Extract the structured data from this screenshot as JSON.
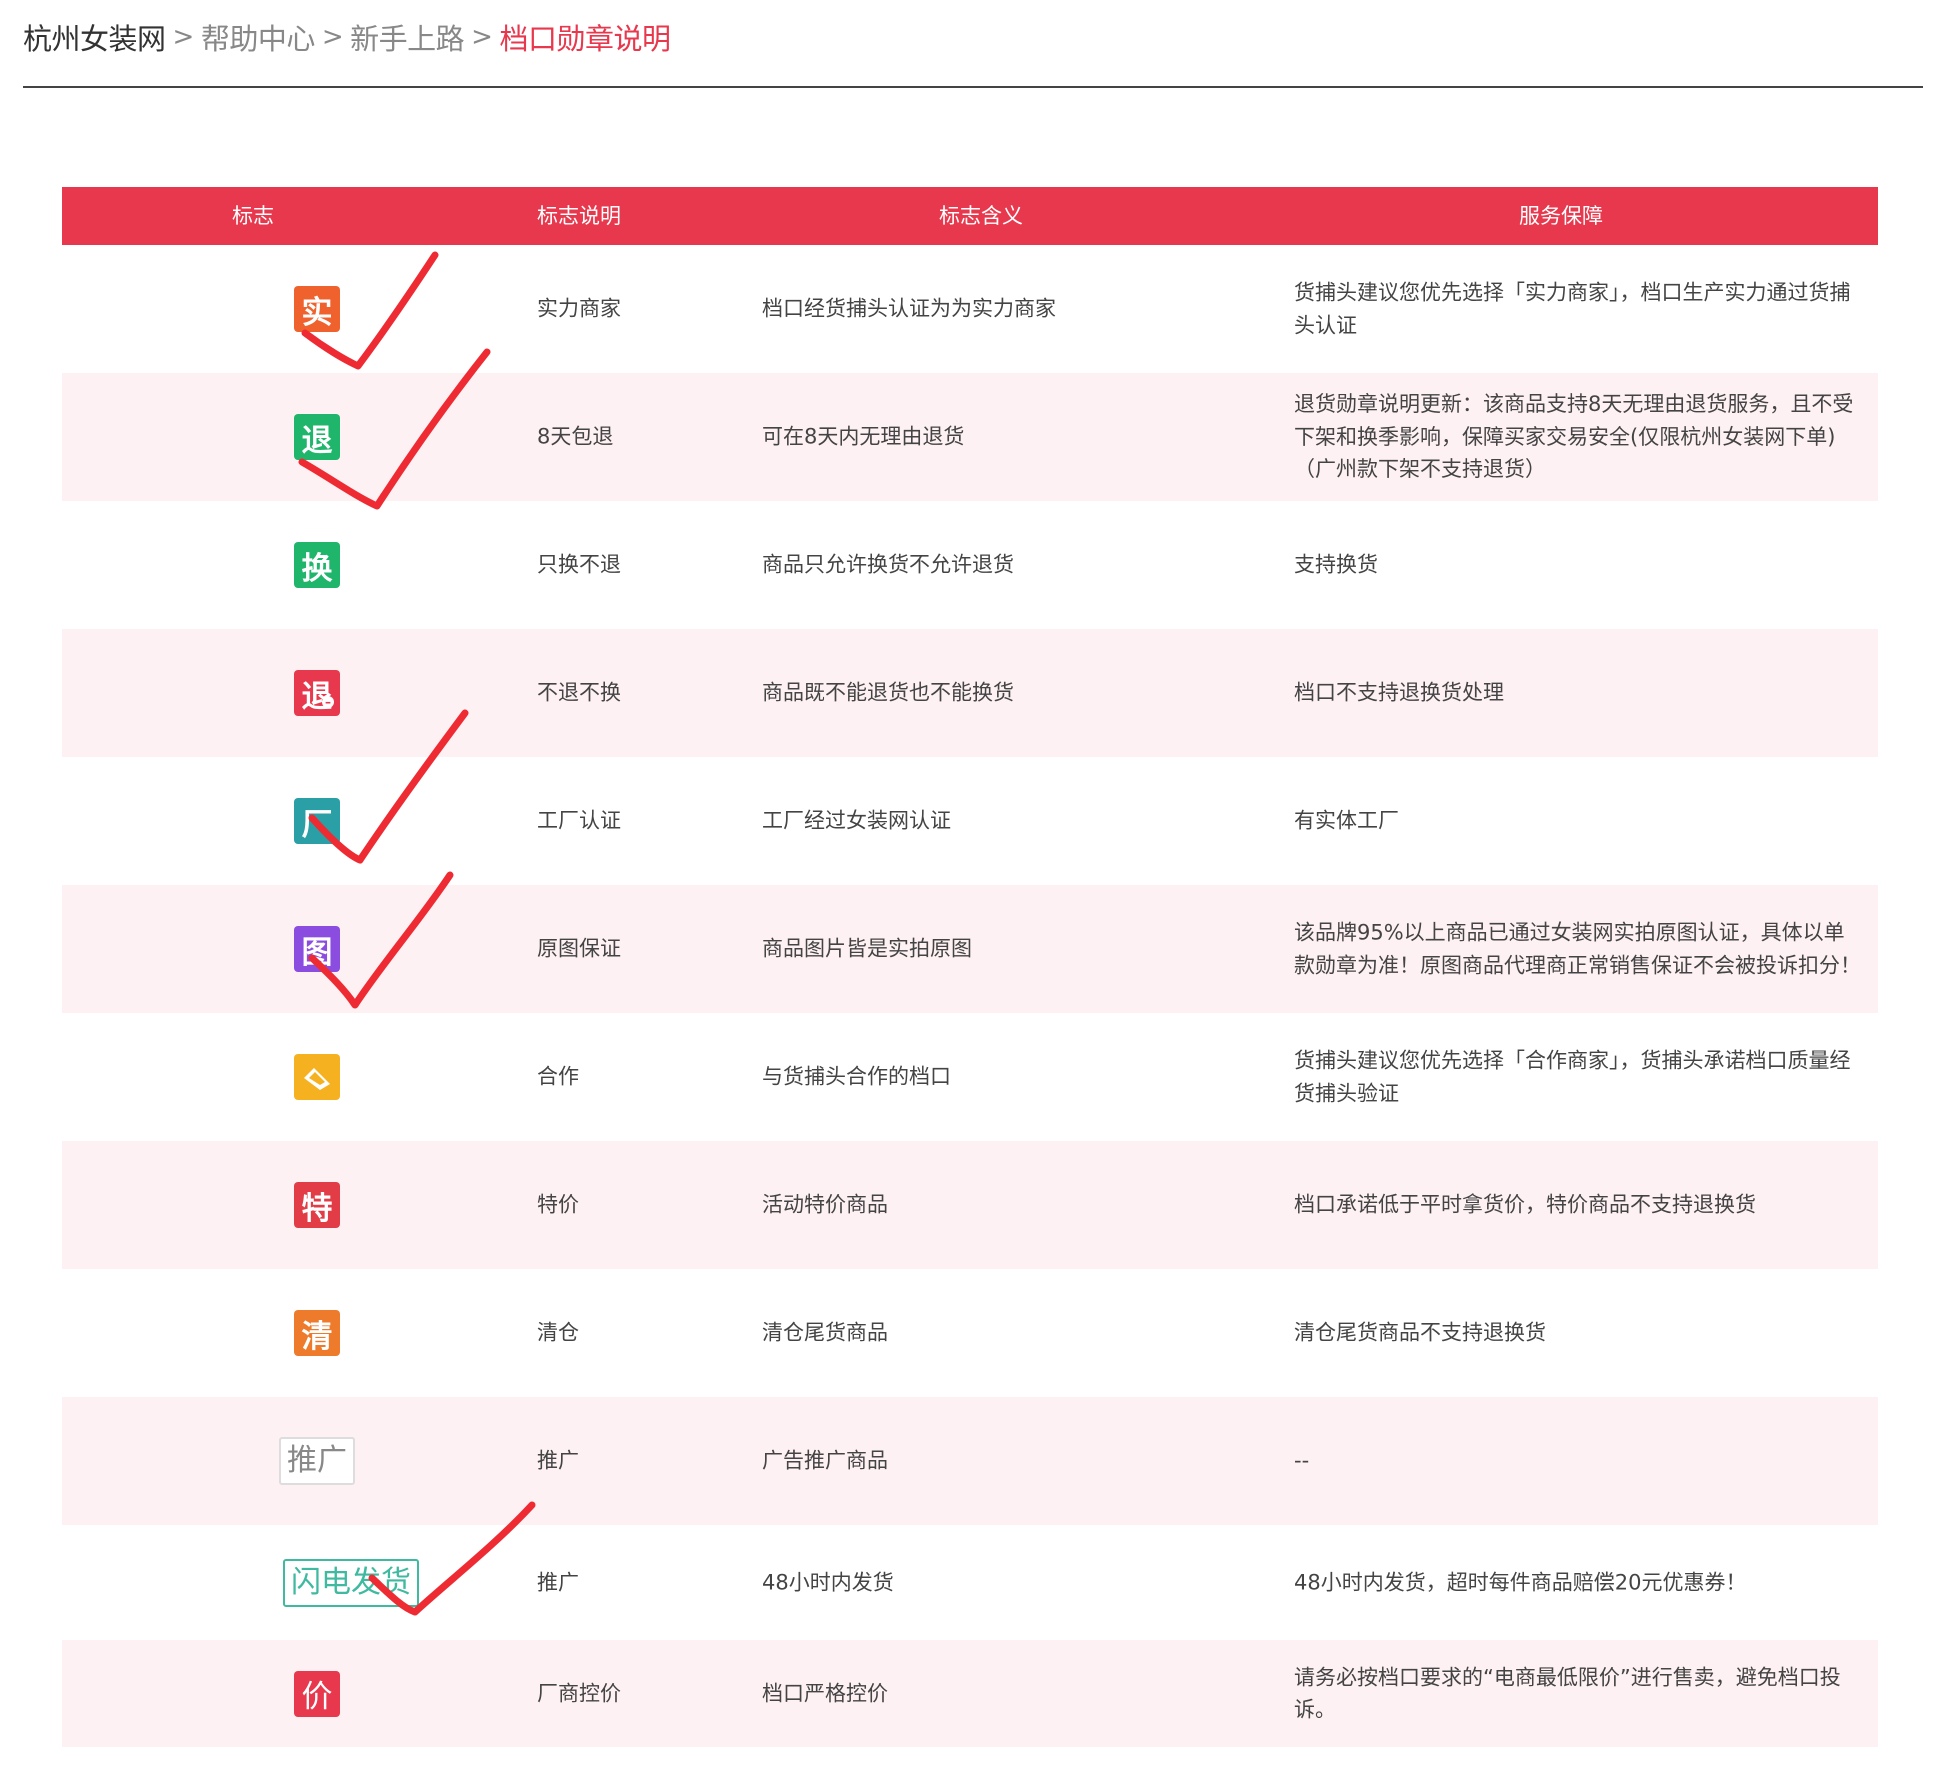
{
  "breadcrumb": {
    "items": [
      "杭州女装网",
      "帮助中心",
      "新手上路",
      "档口勋章说明"
    ],
    "separator": ">"
  },
  "table": {
    "headers": [
      "标志",
      "标志说明",
      "标志含义",
      "服务保障"
    ],
    "rows": [
      {
        "badge_text": "实",
        "badge_color": "#f0622d",
        "name": "实力商家",
        "meaning": "档口经货捕头认证为为实力商家",
        "service": "货捕头建议您优先选择「实力商家」，档口生产实力通过货捕头认证"
      },
      {
        "badge_text": "退",
        "badge_color": "#1fb56a",
        "name": "8天包退",
        "meaning": "可在8天内无理由退货",
        "service": "退货勋章说明更新：该商品支持8天无理由退货服务，且不受下架和换季影响，保障买家交易安全(仅限杭州女装网下单)（广州款下架不支持退货）"
      },
      {
        "badge_text": "换",
        "badge_color": "#1fb56a",
        "name": "只换不退",
        "meaning": "商品只允许换货不允许退货",
        "service": "支持换货"
      },
      {
        "badge_text": "退",
        "badge_color": "#e8384d",
        "name": "不退不换",
        "meaning": "商品既不能退货也不能换货",
        "service": "档口不支持退换货处理"
      },
      {
        "badge_text": "厂",
        "badge_color": "#2a9fa6",
        "name": "工厂认证",
        "meaning": "工厂经过女装网认证",
        "service": "有实体工厂"
      },
      {
        "badge_text": "图",
        "badge_color": "#8a4de0",
        "name": "原图保证",
        "meaning": "商品图片皆是实拍原图",
        "service": "该品牌95%以上商品已通过女装网实拍原图认证，具体以单款勋章为准！原图商品代理商正常销售保证不会被投诉扣分！"
      },
      {
        "badge_text": "",
        "badge_color": "#f5b120",
        "name": "合作",
        "meaning": "与货捕头合作的档口",
        "service": "货捕头建议您优先选择「合作商家」，货捕头承诺档口质量经货捕头验证"
      },
      {
        "badge_text": "特",
        "badge_color": "#e23d47",
        "name": "特价",
        "meaning": "活动特价商品",
        "service": "档口承诺低于平时拿货价，特价商品不支持退换货"
      },
      {
        "badge_text": "清",
        "badge_color": "#ee7b2c",
        "name": "清仓",
        "meaning": "清仓尾货商品",
        "service": "清仓尾货商品不支持退换货"
      },
      {
        "badge_text": "推广",
        "badge_color": "#888888",
        "name": "推广",
        "meaning": "广告推广商品",
        "service": "--"
      },
      {
        "badge_text": "闪电发货",
        "badge_color": "#3fb99f",
        "name": "推广",
        "meaning": "48小时内发货",
        "service": "48小时内发货，超时每件商品赔偿20元优惠券！"
      },
      {
        "badge_text": "价",
        "badge_color": "#e8384d",
        "name": "厂商控价",
        "meaning": "档口严格控价",
        "service": "请务必按档口要求的“电商最低限价”进行售卖，避免档口投诉。"
      }
    ]
  },
  "annotations": {
    "checkmark_color": "#ee2b33",
    "checked_rows": [
      "实力商家",
      "8天包退",
      "工厂认证",
      "原图保证",
      "闪电发货"
    ]
  }
}
